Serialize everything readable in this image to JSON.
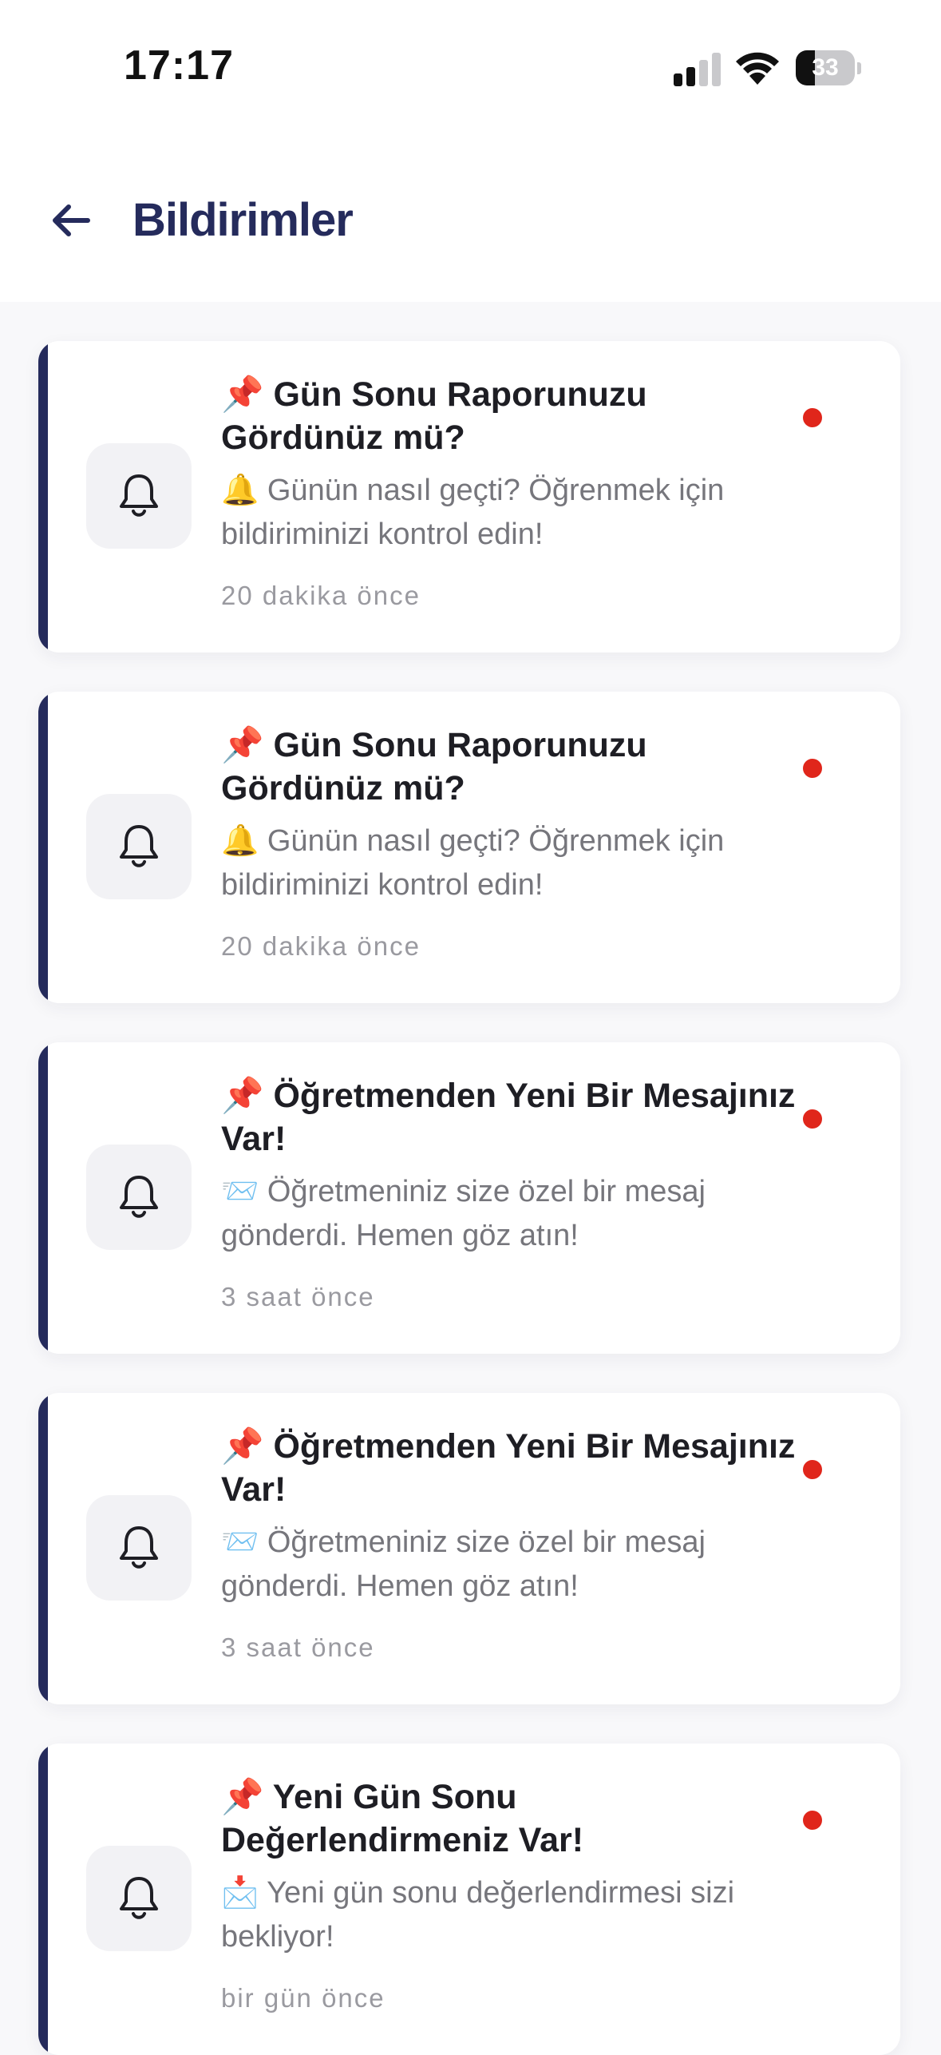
{
  "status_bar": {
    "time": "17:17",
    "battery": "33",
    "battery_level": 0.33,
    "signal_bars": 2
  },
  "header": {
    "title": "Bildirimler",
    "back_icon": "arrow-left-icon"
  },
  "colors": {
    "accent": "#252B5C",
    "unread": "#E0261B",
    "background": "#F8F8FA",
    "card": "#FFFFFF",
    "icon_box": "#F2F2F5"
  },
  "notifications": [
    {
      "icon": "bell-icon",
      "title": "📌 Gün Sonu Raporunuzu Gördünüz mü?",
      "body": "🔔 Günün nasıl geçti? Öğrenmek için bildiriminizi kontrol edin!",
      "time": "20 dakika önce",
      "unread": true
    },
    {
      "icon": "bell-icon",
      "title": "📌 Gün Sonu Raporunuzu Gördünüz mü?",
      "body": "🔔 Günün nasıl geçti? Öğrenmek için bildiriminizi kontrol edin!",
      "time": "20 dakika önce",
      "unread": true
    },
    {
      "icon": "bell-icon",
      "title": "📌 Öğretmenden Yeni Bir Mesajınız Var!",
      "body": "📨 Öğretmeniniz size özel bir mesaj gönderdi. Hemen göz atın!",
      "time": "3 saat önce",
      "unread": true
    },
    {
      "icon": "bell-icon",
      "title": "📌 Öğretmenden Yeni Bir Mesajınız Var!",
      "body": "📨 Öğretmeniniz size özel bir mesaj gönderdi. Hemen göz atın!",
      "time": "3 saat önce",
      "unread": true
    },
    {
      "icon": "bell-icon",
      "title": "📌 Yeni Gün Sonu Değerlendirmeniz Var!",
      "body": "📩 Yeni gün sonu değerlendirmesi sizi bekliyor!",
      "time": "bir gün önce",
      "unread": true
    }
  ]
}
